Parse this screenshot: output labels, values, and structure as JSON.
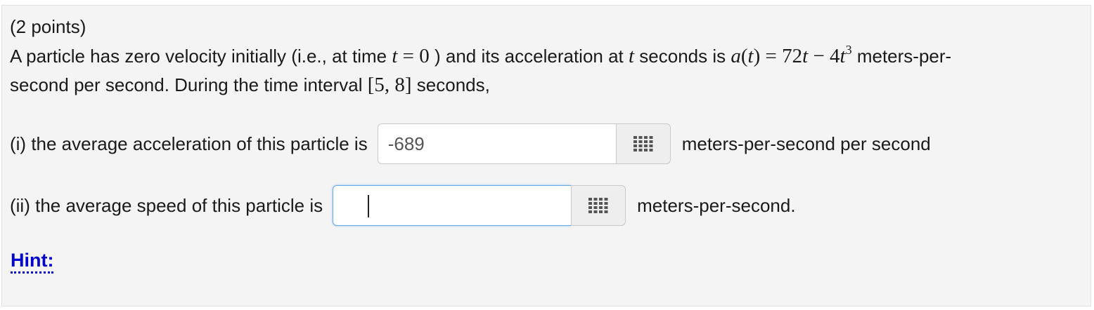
{
  "problem": {
    "points": "(2 points)",
    "statement": {
      "part1": "A particle has zero velocity initially (i.e., at time ",
      "math_t0": "t = 0",
      "part2": " ) and its acceleration at ",
      "math_t": "t",
      "part3": " seconds is ",
      "math_a_lhs": "a(t) = 72t − 4t",
      "math_a_exp": "3",
      "part4": " meters-per-",
      "line2_part1": "second per second. During the time interval ",
      "math_interval": "[5, 8]",
      "line2_part2": " seconds,"
    }
  },
  "q1": {
    "prefix": "(i) the average acceleration of this particle is",
    "value": "-689",
    "suffix": "meters-per-second per second"
  },
  "q2": {
    "prefix": "(ii) the average speed of this particle is",
    "value": "",
    "suffix": "meters-per-second."
  },
  "hint": {
    "label": "Hint:"
  },
  "icons": {
    "palette": "grid-keypad-icon"
  },
  "colors": {
    "link": "#0000cc",
    "focus_border": "#66a8e8",
    "panel_bg": "#f4f4f4"
  }
}
